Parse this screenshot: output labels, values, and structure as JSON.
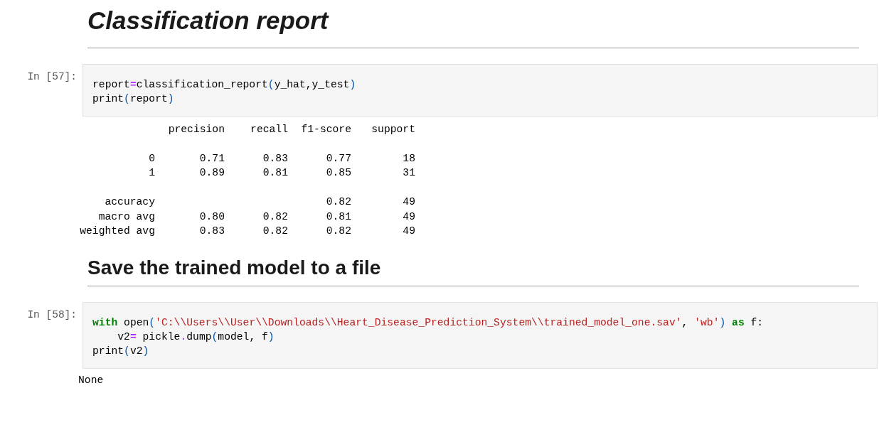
{
  "cells": [
    {
      "kind": "title",
      "text": "Classification report"
    },
    {
      "kind": "code",
      "prompt": "In [57]:",
      "lines": [
        [
          {
            "kind": "plain",
            "s": "report"
          },
          {
            "kind": "op",
            "s": "="
          },
          {
            "kind": "plain",
            "s": "classification_report"
          },
          {
            "kind": "paren",
            "s": "("
          },
          {
            "kind": "plain",
            "s": "y_hat,y_test"
          },
          {
            "kind": "paren",
            "s": ")"
          }
        ],
        [
          {
            "kind": "plain",
            "s": "print"
          },
          {
            "kind": "paren",
            "s": "("
          },
          {
            "kind": "plain",
            "s": "report"
          },
          {
            "kind": "paren",
            "s": ")"
          }
        ]
      ]
    },
    {
      "kind": "report",
      "columns": [
        "precision",
        "recall",
        "f1-score",
        "support"
      ],
      "rows": [
        [
          "0",
          "0.71",
          "0.83",
          "0.77",
          "18"
        ],
        [
          "1",
          "0.89",
          "0.81",
          "0.85",
          "31"
        ],
        null,
        [
          "accuracy",
          null,
          null,
          "0.82",
          "49"
        ],
        [
          "macro avg",
          "0.80",
          "0.82",
          "0.81",
          "49"
        ],
        [
          "weighted avg",
          "0.83",
          "0.82",
          "0.82",
          "49"
        ]
      ]
    },
    {
      "kind": "section",
      "text": "Save the trained model to a file"
    },
    {
      "kind": "code",
      "prompt": "In [58]:",
      "lines": [
        [
          {
            "kind": "kw",
            "s": "with"
          },
          {
            "kind": "plain",
            "s": " open"
          },
          {
            "kind": "paren",
            "s": "("
          },
          {
            "kind": "str",
            "s": "'C:\\\\Users\\\\User\\\\Downloads\\\\Heart_Disease_Prediction_System\\\\trained_model_one.sav'"
          },
          {
            "kind": "plain",
            "s": ", "
          },
          {
            "kind": "str",
            "s": "'wb'"
          },
          {
            "kind": "paren",
            "s": ")"
          },
          {
            "kind": "kw",
            "s": " as"
          },
          {
            "kind": "plain",
            "s": " f:"
          }
        ],
        [
          {
            "kind": "plain",
            "s": "    v2"
          },
          {
            "kind": "op",
            "s": "="
          },
          {
            "kind": "plain",
            "s": " pickle"
          },
          {
            "kind": "op",
            "s": "."
          },
          {
            "kind": "plain",
            "s": "dump"
          },
          {
            "kind": "paren",
            "s": "("
          },
          {
            "kind": "plain",
            "s": "model, f"
          },
          {
            "kind": "paren",
            "s": ")"
          }
        ],
        [
          {
            "kind": "plain",
            "s": "print"
          },
          {
            "kind": "paren",
            "s": "("
          },
          {
            "kind": "plain",
            "s": "v2"
          },
          {
            "kind": "paren",
            "s": ")"
          }
        ]
      ]
    },
    {
      "kind": "stdout",
      "text": "None"
    }
  ]
}
